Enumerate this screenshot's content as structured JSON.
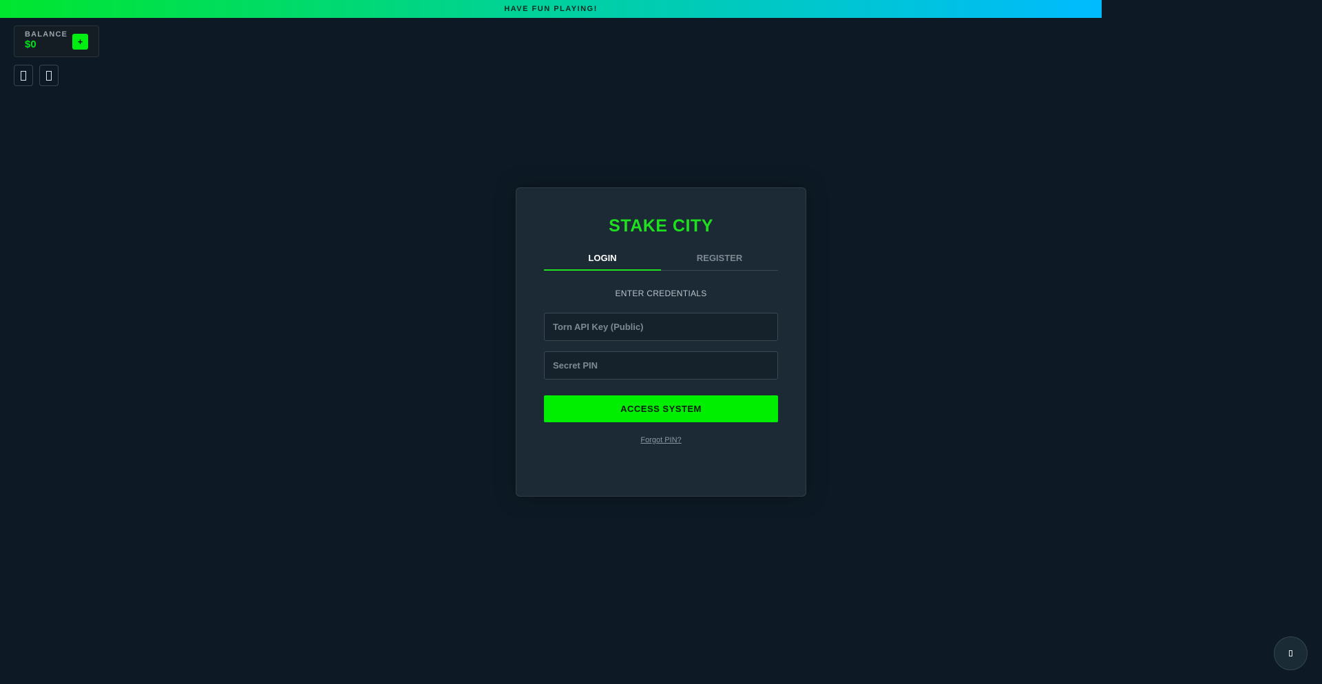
{
  "banner": {
    "text": "HAVE FUN PLAYING!"
  },
  "balance": {
    "label": "BALANCE",
    "amount": "$0",
    "deposit_label": "+"
  },
  "toolbar": {
    "icons": [
      "missing-glyph-icon",
      "missing-glyph-icon"
    ]
  },
  "auth": {
    "title": "STAKE CITY",
    "tabs": [
      {
        "label": "LOGIN",
        "active": true
      },
      {
        "label": "REGISTER",
        "active": false
      }
    ],
    "subtitle": "ENTER CREDENTIALS",
    "api_key": {
      "value": "",
      "placeholder": "Torn API Key (Public)"
    },
    "pin": {
      "value": "",
      "placeholder": "Secret PIN"
    },
    "submit_label": "ACCESS SYSTEM",
    "forgot_label": "Forgot PIN?"
  },
  "floating_button": {
    "icon": "missing-glyph-icon"
  },
  "colors": {
    "accent": "#00ee00",
    "background": "#0d1a25",
    "card": "#1b2a35"
  }
}
